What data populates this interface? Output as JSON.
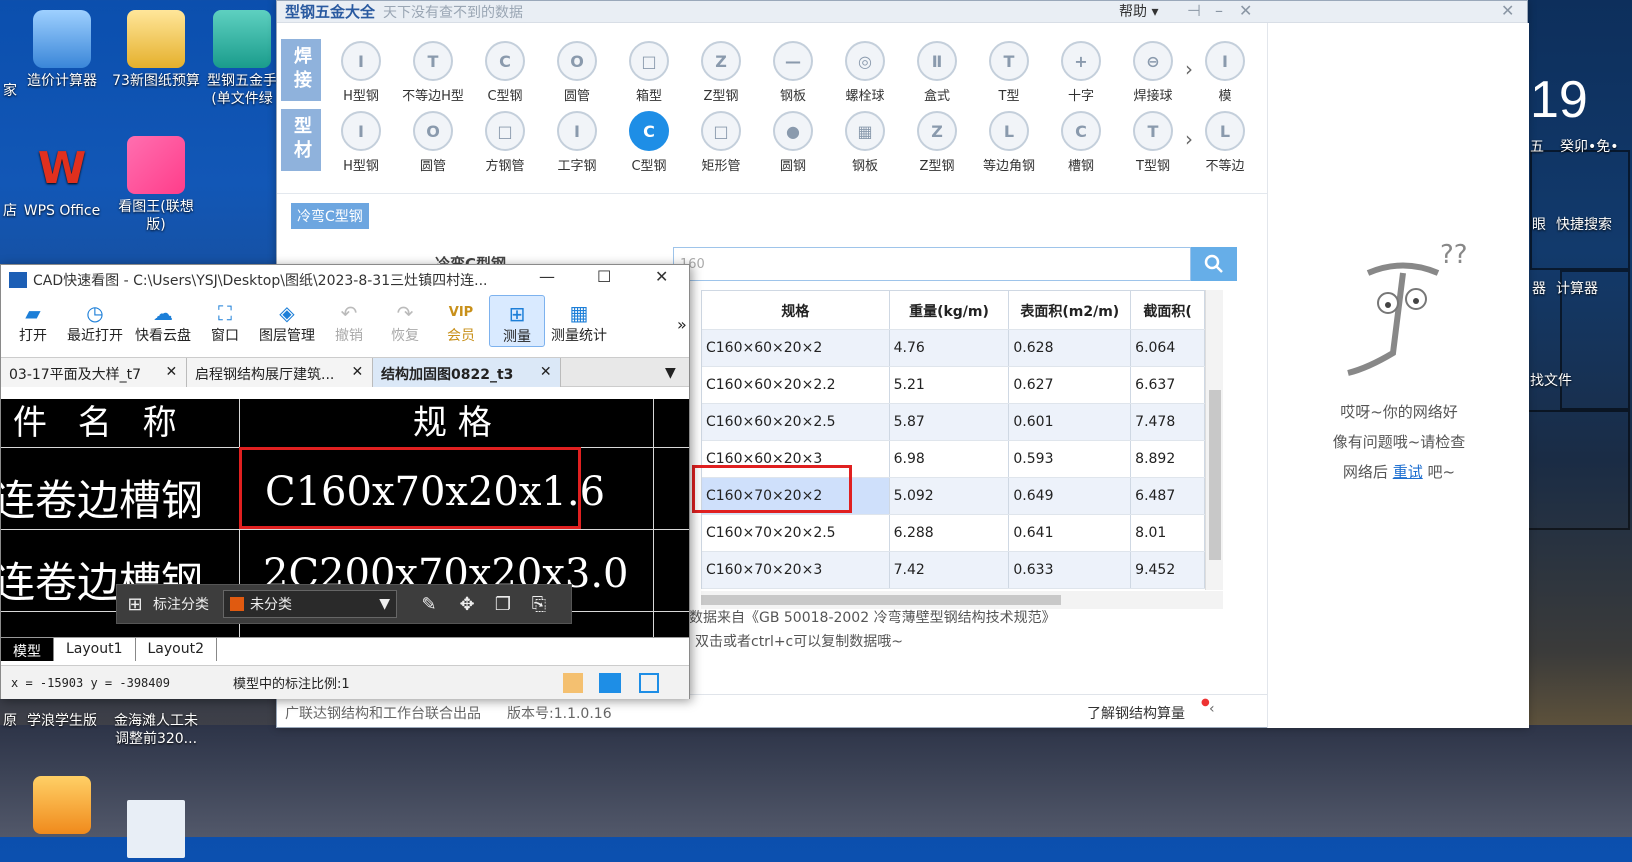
{
  "desktop": {
    "icons": [
      {
        "label": "家",
        "name": "partial-icon-left-top"
      },
      {
        "label": "造价计算器",
        "name": "cost-calculator-icon"
      },
      {
        "label": "73新图纸预算",
        "name": "folder-73-icon"
      },
      {
        "label": "型钢五金手\n(单文件绿",
        "name": "steel-handbook-icon"
      },
      {
        "label": "店",
        "name": "partial-icon-left-mid"
      },
      {
        "label": "WPS Office",
        "name": "wps-office-icon"
      },
      {
        "label": "看图王(联想\n版)",
        "name": "image-viewer-icon"
      },
      {
        "label": "原",
        "name": "partial-icon-left-bottom"
      },
      {
        "label": "学浪学生版",
        "name": "xuelang-icon"
      },
      {
        "label": "金海滩人工未\n调整前320...",
        "name": "jinhaitan-icon"
      }
    ],
    "widget": {
      "big_number": "19",
      "date_a": "五",
      "date_b": "癸卯•免•",
      "search_label": "快捷搜索",
      "search_prefix": "眼",
      "calc_label": "计算器",
      "calc_prefix": "器",
      "file_label": "找文件"
    }
  },
  "steel_app": {
    "title": "型钢五金大全",
    "subtitle": "天下没有查不到的数据",
    "help": "帮助 ▾",
    "weld_tab": "焊接",
    "profile_tab": "型材",
    "weld_items": [
      "H型钢",
      "不等边H型",
      "C型钢",
      "圆管",
      "箱型",
      "Z型钢",
      "钢板",
      "螺栓球",
      "盒式",
      "T型",
      "十字",
      "焊接球",
      "模"
    ],
    "weld_glyphs": [
      "I",
      "T",
      "C",
      "O",
      "□",
      "Z",
      "—",
      "◎",
      "Ⅱ",
      "T",
      "+",
      "⊖",
      "I"
    ],
    "profile_items": [
      "H型钢",
      "圆管",
      "方钢管",
      "工字钢",
      "C型钢",
      "矩形管",
      "圆钢",
      "钢板",
      "Z型钢",
      "等边角钢",
      "槽钢",
      "T型钢",
      "不等边"
    ],
    "profile_glyphs": [
      "I",
      "O",
      "□",
      "I",
      "C",
      "□",
      "●",
      "▦",
      "Z",
      "L",
      "C",
      "T",
      "L"
    ],
    "selected_profile_index": 4,
    "breadcrumb": "冷弯C型钢",
    "section_title": "冷弯C型钢",
    "search_value": "160",
    "table": {
      "headers": [
        "规格",
        "重量(kg/m)",
        "表面积(m2/m)",
        "截面积("
      ],
      "rows": [
        [
          "C160×60×20×2",
          "4.76",
          "0.628",
          "6.064"
        ],
        [
          "C160×60×20×2.2",
          "5.21",
          "0.627",
          "6.637"
        ],
        [
          "C160×60×20×2.5",
          "5.87",
          "0.601",
          "7.478"
        ],
        [
          "C160×60×20×3",
          "6.98",
          "0.593",
          "8.892"
        ],
        [
          "C160×70×20×2",
          "5.092",
          "0.649",
          "6.487"
        ],
        [
          "C160×70×20×2.5",
          "6.288",
          "0.641",
          "8.01"
        ],
        [
          "C160×70×20×3",
          "7.42",
          "0.633",
          "9.452"
        ]
      ],
      "highlight_row": 4
    },
    "source_note": "本数据来自《GB  50018-2002  冷弯薄壁型钢结构技术规范》",
    "copy_note": "注：双击或者ctrl+c可以复制数据哦~",
    "footer_publisher": "广联达钢结构和工作台联合出品",
    "footer_version": "版本号:1.1.0.16",
    "footer_link": "了解钢结构算量",
    "error_line1": "哎呀~你的网络好",
    "error_line2": "像有问题哦~请检查",
    "error_line3_pre": "网络后",
    "retry": "重试",
    "error_line3_post": "吧~"
  },
  "cad": {
    "title": "CAD快速看图 - C:\\Users\\YSJ\\Desktop\\图纸\\2023-8-31三灶镇四村连...",
    "ribbon": [
      {
        "label": "打开",
        "icon": "open-folder-icon",
        "glyph": "▰",
        "state": "normal"
      },
      {
        "label": "最近打开",
        "icon": "recent-icon",
        "glyph": "◷",
        "state": "normal"
      },
      {
        "label": "快看云盘",
        "icon": "cloud-icon",
        "glyph": "☁",
        "state": "normal"
      },
      {
        "label": "窗口",
        "icon": "window-icon",
        "glyph": "⛶",
        "state": "normal"
      },
      {
        "label": "图层管理",
        "icon": "layers-icon",
        "glyph": "◈",
        "state": "normal"
      },
      {
        "label": "撤销",
        "icon": "undo-icon",
        "glyph": "↶",
        "state": "disabled"
      },
      {
        "label": "恢复",
        "icon": "redo-icon",
        "glyph": "↷",
        "state": "disabled"
      },
      {
        "label": "会员",
        "icon": "vip-icon",
        "glyph": "VIP",
        "state": "vip"
      },
      {
        "label": "测量",
        "icon": "measure-icon",
        "glyph": "⊞",
        "state": "active"
      },
      {
        "label": "测量统计",
        "icon": "measure-stats-icon",
        "glyph": "▦",
        "state": "normal"
      }
    ],
    "more": "»",
    "tabs": [
      "03-17平面及大样_t7",
      "启程钢结构展厅建筑...",
      "结构加固图0822_t3"
    ],
    "active_tab": 2,
    "drawing": {
      "header_left": "件 名 称",
      "header_right": "规    格",
      "row1_left": "连卷边槽钢",
      "row1_right": "C160x70x20x1.6",
      "row2_left": "连卷边槽钢",
      "row2_right": "2C200x70x20x3.0"
    },
    "float_bar_label": "标注分类",
    "float_bar_select": "未分类",
    "layout_tabs": [
      "模型",
      "Layout1",
      "Layout2"
    ],
    "status_coords": "x = -15903  y = -398409",
    "status_scale": "模型中的标注比例:1"
  }
}
